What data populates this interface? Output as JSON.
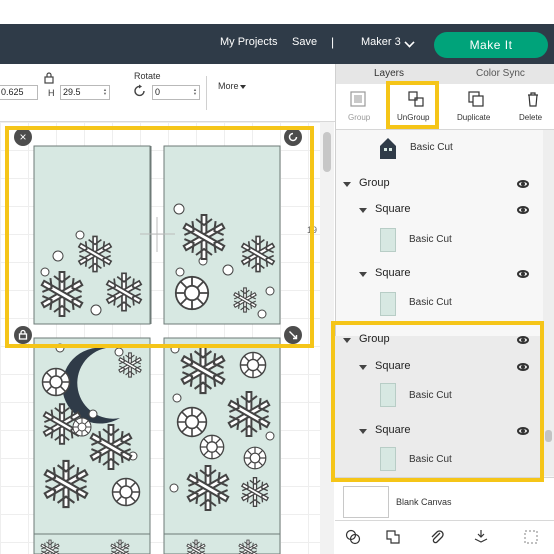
{
  "header": {
    "my_projects": "My Projects",
    "save": "Save",
    "separator": "|",
    "machine": "Maker 3",
    "make_it": "Make It"
  },
  "edit_bar": {
    "width_value": "0.625",
    "h_label": "H",
    "height_value": "29.5",
    "rotate_label": "Rotate",
    "rotate_value": "0",
    "more_label": "More"
  },
  "panel": {
    "tabs": [
      "Layers",
      "Color Sync"
    ],
    "tools": [
      "Group",
      "UnGroup",
      "Duplicate",
      "Delete"
    ],
    "top_item_label": "Basic Cut",
    "group1": {
      "label": "Group",
      "children": [
        {
          "label": "Square",
          "sub": "Basic Cut"
        },
        {
          "label": "Square",
          "sub": "Basic Cut"
        }
      ]
    },
    "group2": {
      "label": "Group",
      "children": [
        {
          "label": "Square",
          "sub": "Basic Cut"
        },
        {
          "label": "Square",
          "sub": "Basic Cut"
        }
      ]
    },
    "blank_canvas": "Blank Canvas"
  },
  "canvas": {
    "ruler_number": "19"
  },
  "colors": {
    "topbar": "#2f3b48",
    "accent": "#00a37a",
    "panel_fill": "#d7e8e2",
    "highlight": "#f5c518"
  }
}
